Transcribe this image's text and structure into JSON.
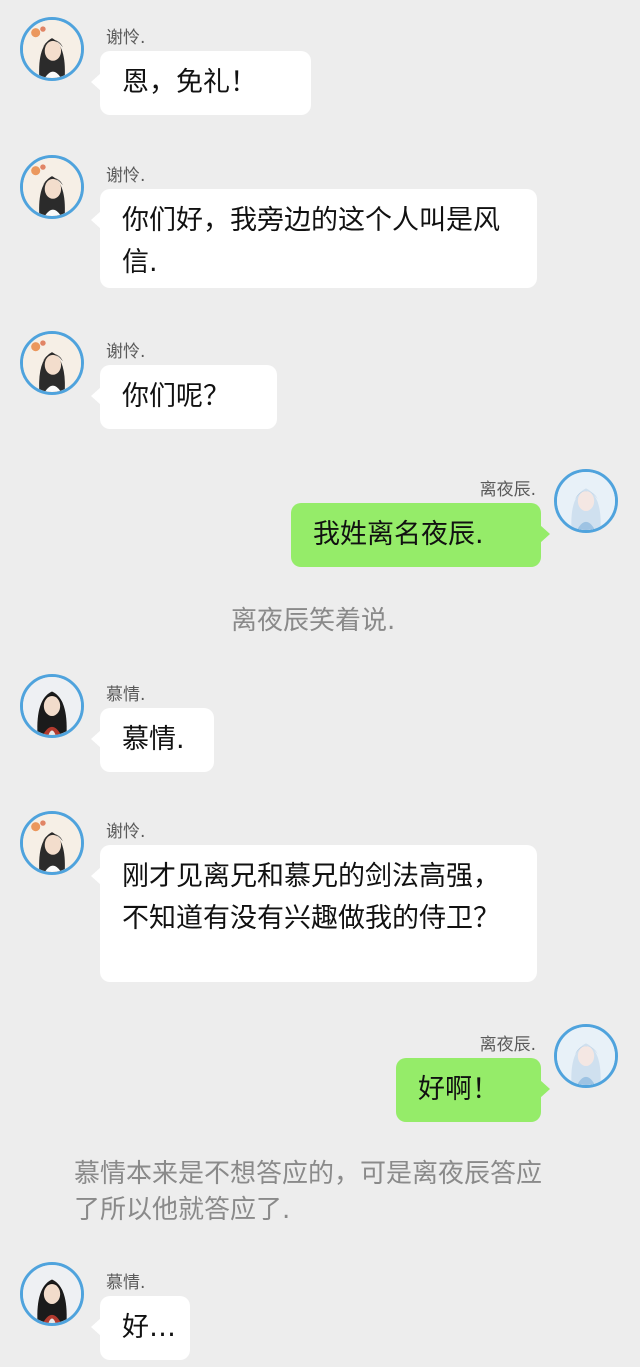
{
  "colors": {
    "background": "#ededed",
    "left_bubble": "#ffffff",
    "right_bubble": "#95ec69",
    "avatar_ring": "#4fa3dd",
    "narration_text": "#8a8a8a"
  },
  "messages": [
    {
      "side": "left",
      "sender": "谢怜.",
      "avatar": "xie-lian-avatar",
      "text": "恩，免礼！"
    },
    {
      "side": "left",
      "sender": "谢怜.",
      "avatar": "xie-lian-avatar",
      "text": "你们好，我旁边的这个人叫是风信."
    },
    {
      "side": "left",
      "sender": "谢怜.",
      "avatar": "xie-lian-avatar",
      "text": "你们呢？"
    },
    {
      "side": "right",
      "sender": "离夜辰.",
      "avatar": "li-ye-chen-avatar",
      "text": "我姓离名夜辰."
    },
    {
      "type": "narration",
      "text": "离夜辰笑着说."
    },
    {
      "side": "left",
      "sender": "慕情.",
      "avatar": "mu-qing-avatar",
      "text": "慕情."
    },
    {
      "side": "left",
      "sender": "谢怜.",
      "avatar": "xie-lian-avatar",
      "text": "刚才见离兄和慕兄的剑法高强，不知道有没有兴趣做我的侍卫？"
    },
    {
      "side": "right",
      "sender": "离夜辰.",
      "avatar": "li-ye-chen-avatar",
      "text": "好啊！"
    },
    {
      "type": "narration",
      "text": "慕情本来是不想答应的，可是离夜辰答应了所以他就答应了."
    },
    {
      "side": "left",
      "sender": "慕情.",
      "avatar": "mu-qing-avatar",
      "text": "好…"
    }
  ]
}
